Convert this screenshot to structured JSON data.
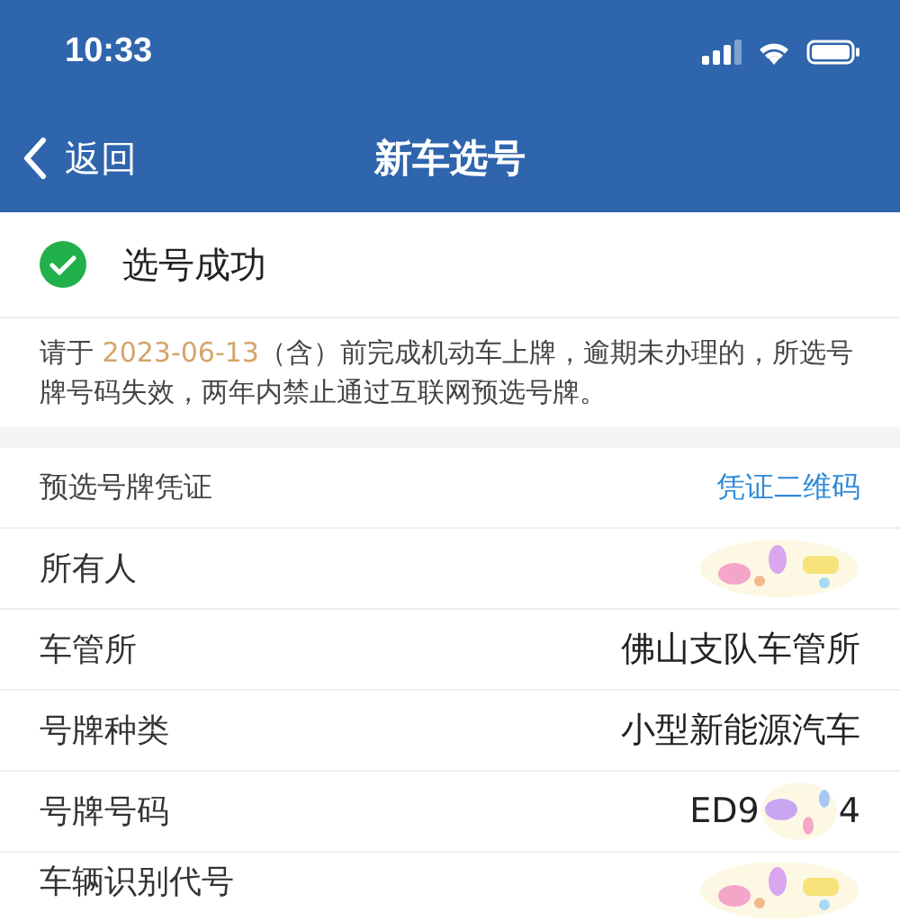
{
  "status_bar": {
    "time": "10:33"
  },
  "nav": {
    "back": "返回",
    "title": "新车选号"
  },
  "result": {
    "success": true,
    "message": "选号成功"
  },
  "notice": "请于 **2023-06-13**（含）前完成机动车上牌，逾期未办理的，所选号牌号码失效，两年内禁止通过互联网预选号牌。",
  "voucher": {
    "label": "预选号牌凭证",
    "link": "凭证二维码"
  },
  "rows": [
    {
      "label": "所有人",
      "kind": "masked"
    },
    {
      "label": "车管所",
      "value": "佛山支队车管所",
      "kind": "text"
    },
    {
      "label": "号牌种类",
      "value": "小型新能源汽车",
      "kind": "text"
    },
    {
      "label": "号牌号码",
      "value_parts": [
        "ED9",
        "4"
      ],
      "kind": "partly_masked"
    },
    {
      "label": "车辆识别代号",
      "kind": "masked"
    }
  ]
}
